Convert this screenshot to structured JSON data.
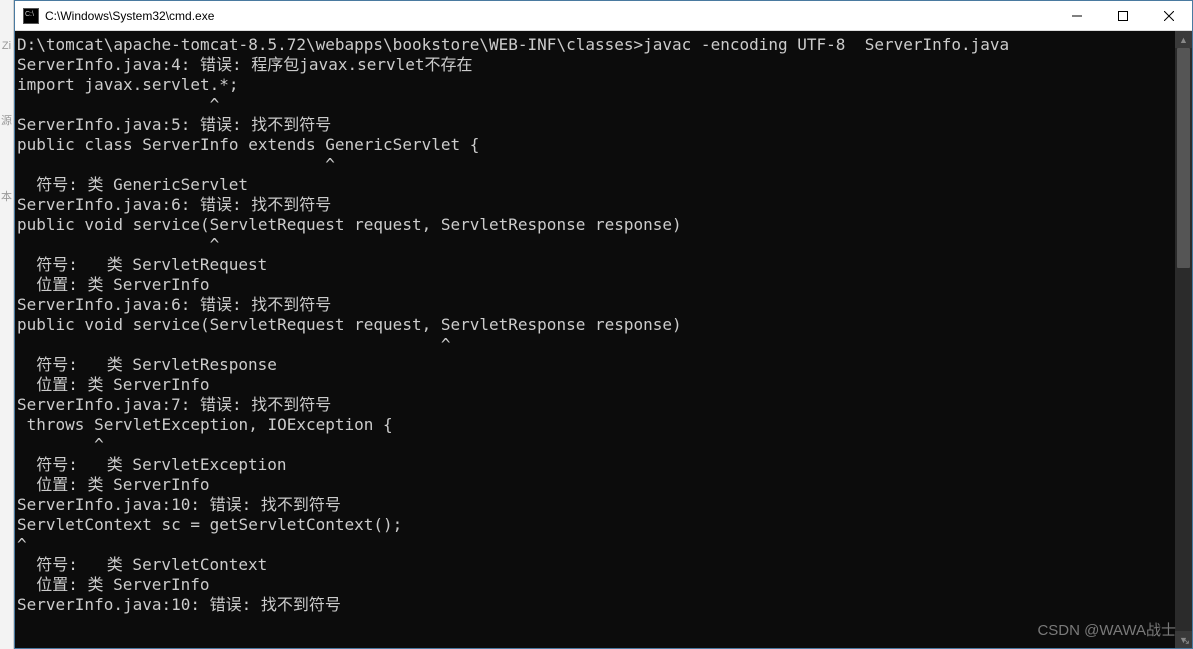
{
  "gutter": {
    "a": "Zi",
    "b": "源",
    "c": "本"
  },
  "titlebar": {
    "title": "C:\\Windows\\System32\\cmd.exe"
  },
  "winbuttons": {
    "minimize": "minimize",
    "maximize": "maximize",
    "close": "close"
  },
  "console": {
    "lines": [
      "",
      "D:\\tomcat\\apache-tomcat-8.5.72\\webapps\\bookstore\\WEB-INF\\classes>javac -encoding UTF-8  ServerInfo.java",
      "ServerInfo.java:4: 错误: 程序包javax.servlet不存在",
      "import javax.servlet.*;",
      "                    ^",
      "ServerInfo.java:5: 错误: 找不到符号",
      "public class ServerInfo extends GenericServlet {",
      "                                ^",
      "  符号: 类 GenericServlet",
      "ServerInfo.java:6: 错误: 找不到符号",
      "public void service(ServletRequest request, ServletResponse response)",
      "                    ^",
      "  符号:   类 ServletRequest",
      "  位置: 类 ServerInfo",
      "ServerInfo.java:6: 错误: 找不到符号",
      "public void service(ServletRequest request, ServletResponse response)",
      "                                            ^",
      "  符号:   类 ServletResponse",
      "  位置: 类 ServerInfo",
      "ServerInfo.java:7: 错误: 找不到符号",
      " throws ServletException, IOException {",
      "        ^",
      "  符号:   类 ServletException",
      "  位置: 类 ServerInfo",
      "ServerInfo.java:10: 错误: 找不到符号",
      "ServletContext sc = getServletContext();",
      "^",
      "  符号:   类 ServletContext",
      "  位置: 类 ServerInfo",
      "ServerInfo.java:10: 错误: 找不到符号"
    ]
  },
  "watermark": "CSDN @WAWA战士"
}
